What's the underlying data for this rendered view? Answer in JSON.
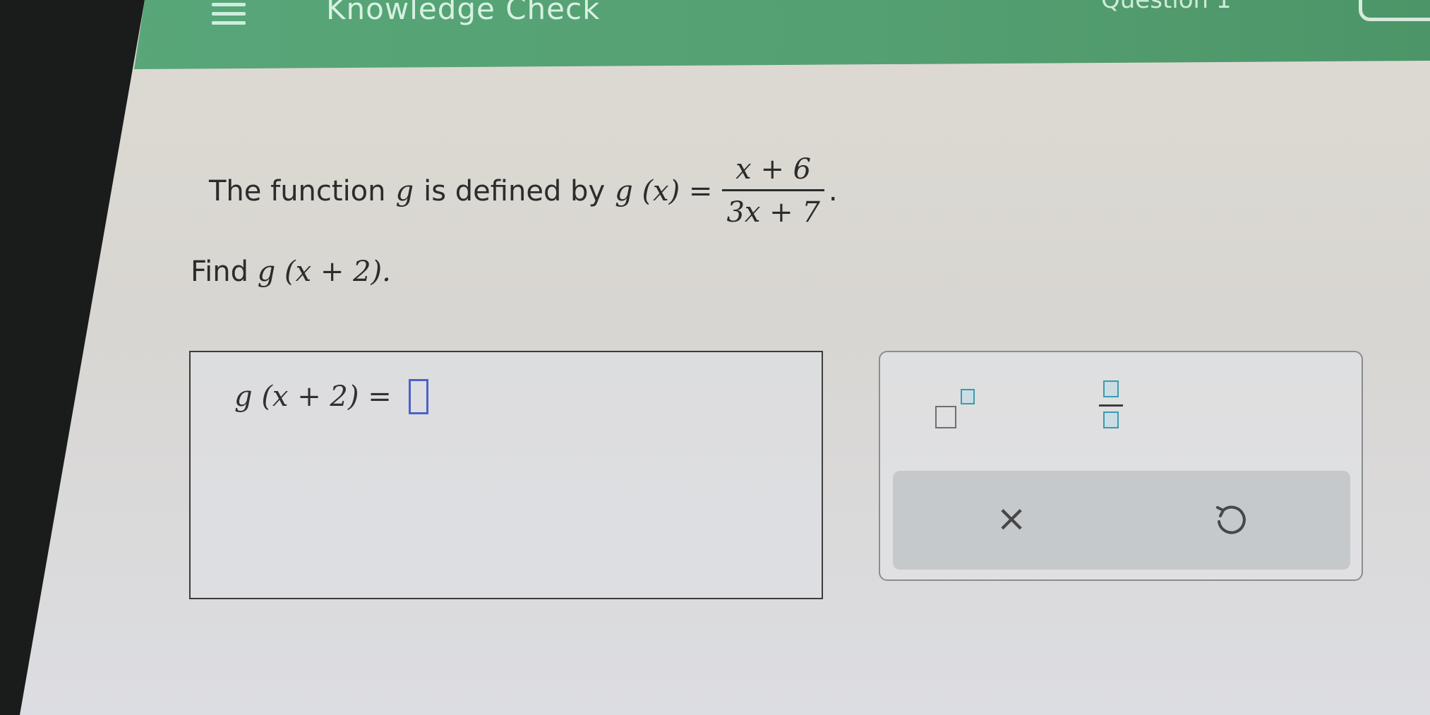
{
  "header": {
    "title": "Knowledge Check",
    "question_label": "Question 1"
  },
  "problem": {
    "intro_text": "The function",
    "fn_var": "g",
    "defined_text": "is defined by",
    "lhs": "g (x) =",
    "fraction_numerator": "x + 6",
    "fraction_denominator": "3x + 7",
    "period": ".",
    "find_text": "Find",
    "find_expr": "g (x + 2)."
  },
  "answer": {
    "lhs": "g (x + 2) ="
  },
  "toolbox": {
    "clear_symbol": "×"
  },
  "colors": {
    "header_green": "#58a77a",
    "answer_slot_blue": "#4a63c8",
    "tool_accent_teal": "#3a9bb0"
  },
  "icons": {
    "menu": "hamburger-menu-icon",
    "exponent": "exponent-template-icon",
    "fraction": "fraction-template-icon",
    "clear": "close-x-icon",
    "undo": "undo-arrow-icon"
  }
}
